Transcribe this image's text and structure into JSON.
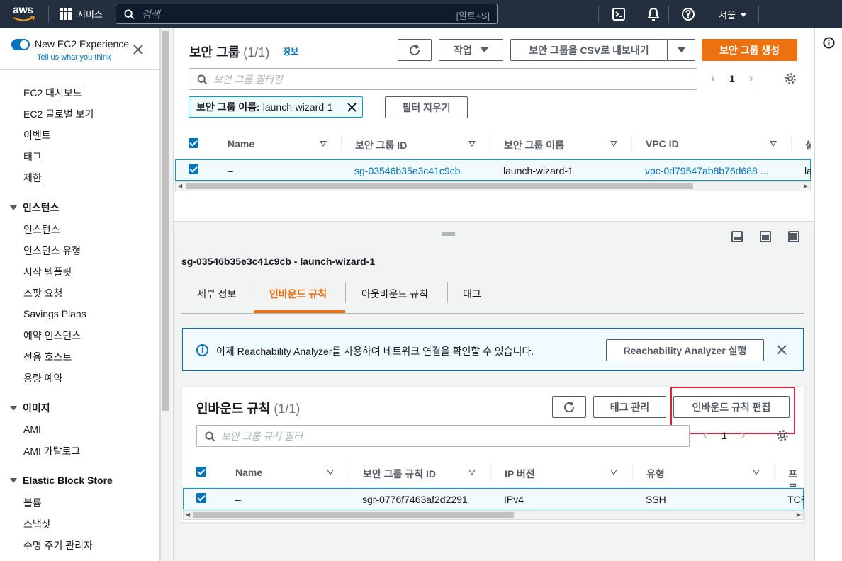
{
  "topbar": {
    "logo_text": "aws",
    "services_label": "서비스",
    "search_placeholder": "검색",
    "search_shortcut": "[알트+S]",
    "region_label": "서울"
  },
  "sidebar": {
    "new_experience_title": "New EC2 Experience",
    "new_experience_sub": "Tell us what you think",
    "items_top": [
      "EC2 대시보드",
      "EC2 글로벌 보기",
      "이벤트",
      "태그",
      "제한"
    ],
    "section_instances": "인스턴스",
    "items_instances": [
      "인스턴스",
      "인스턴스 유형",
      "시작 템플릿",
      "스팟 요청",
      "Savings Plans",
      "예약 인스턴스",
      "전용 호스트",
      "용량 예약"
    ],
    "section_images": "이미지",
    "items_images": [
      "AMI",
      "AMI 카탈로그"
    ],
    "section_ebs": "Elastic Block Store",
    "items_ebs": [
      "볼륨",
      "스냅샷",
      "수명 주기 관리자"
    ]
  },
  "sg_list": {
    "title": "보안 그룹",
    "count": "(1/1)",
    "info": "정보",
    "actions_label": "작업",
    "export_label": "보안 그룹을 CSV로 내보내기",
    "create_label": "보안 그룹 생성",
    "filter_placeholder": "보안 그룹 필터링",
    "page": "1",
    "token_key": "보안 그룹 이름:",
    "token_value": "launch-wizard-1",
    "clear_filter_label": "필터 지우기",
    "columns": [
      "Name",
      "보안 그룹 ID",
      "보안 그룹 이름",
      "VPC ID",
      "설"
    ],
    "row": {
      "name": "–",
      "id": "sg-03546b35e3c41c9cb",
      "group_name": "launch-wizard-1",
      "vpc": "vpc-0d79547ab8b76d688 ...",
      "desc": "la"
    }
  },
  "detail": {
    "title": "sg-03546b35e3c41c9cb - launch-wizard-1",
    "tabs": [
      "세부 정보",
      "인바운드 규칙",
      "아웃바운드 규칙",
      "태그"
    ],
    "alert_text": "이제 Reachability Analyzer를 사용하여 네트워크 연결을 확인할 수 있습니다.",
    "alert_button": "Reachability Analyzer 실행",
    "inbound_title": "인바운드 규칙",
    "inbound_count": "(1/1)",
    "manage_tags_label": "태그 관리",
    "edit_inbound_label": "인바운드 규칙 편집",
    "rule_filter_placeholder": "보안 그룹 규칙 필터",
    "page": "1",
    "columns": [
      "Name",
      "보안 그룹 규칙 ID",
      "IP 버전",
      "유형",
      "프로"
    ],
    "row": {
      "name": "–",
      "rule_id": "sgr-0776f7463af2d2291",
      "ip_version": "IPv4",
      "type": "SSH",
      "protocol": "TCP"
    }
  },
  "colors": {
    "accent": "#ec7211",
    "link": "#0073bb",
    "highlight": "#e0203a",
    "header_bg": "#232f3e"
  }
}
